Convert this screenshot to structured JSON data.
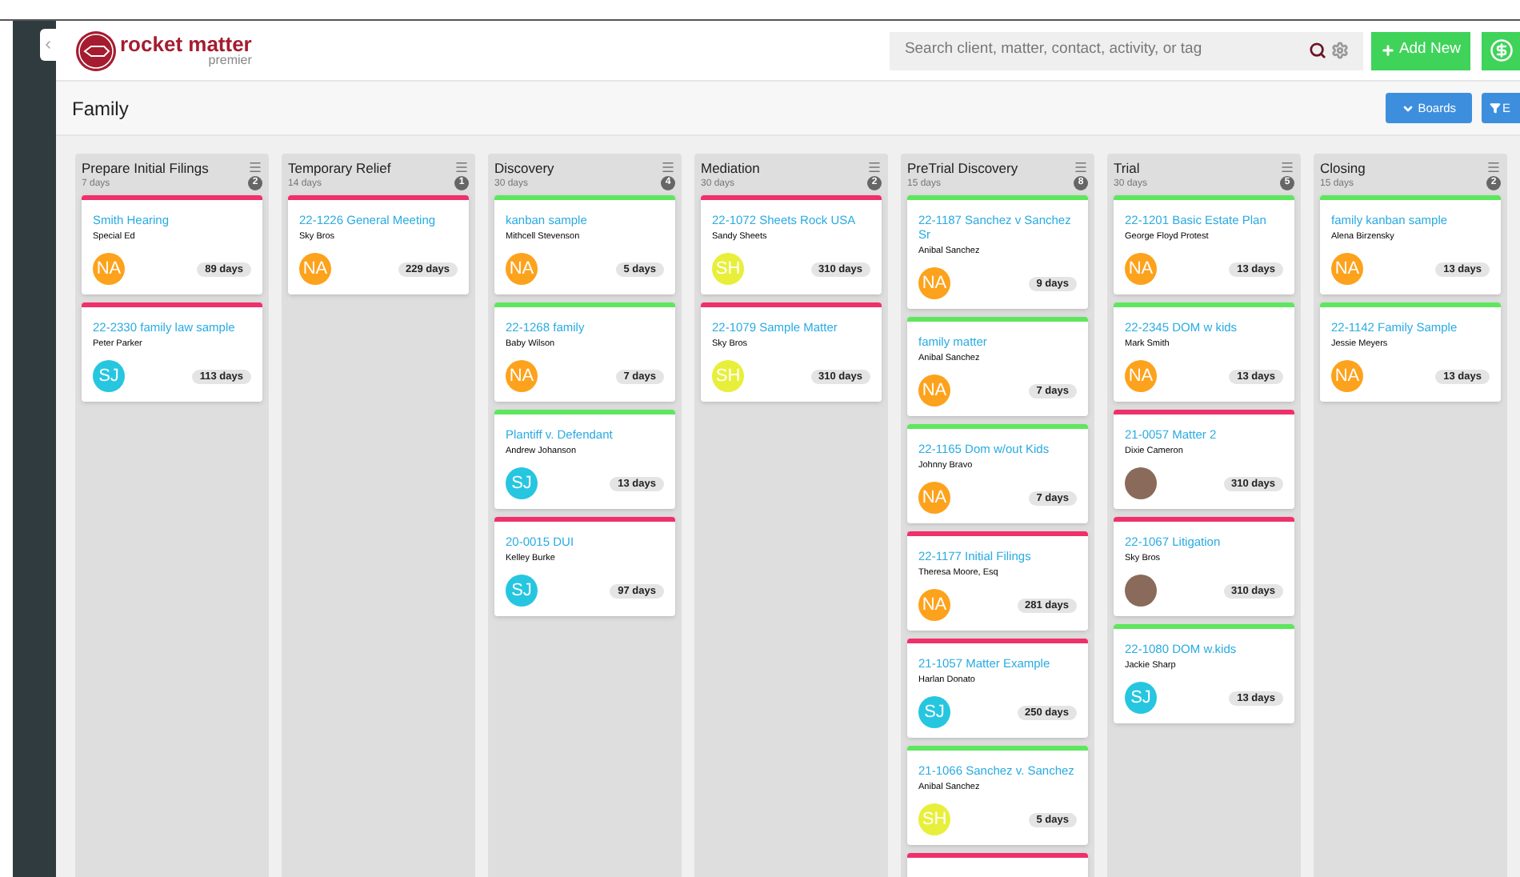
{
  "logo": {
    "name": "rocket matter",
    "tier": "premier"
  },
  "search": {
    "placeholder": "Search client, matter, contact, activity, or tag"
  },
  "add_button": {
    "label": "Add New"
  },
  "page_title": "Family",
  "boards_button": {
    "label": "Boards"
  },
  "filter_button": {
    "label": "E"
  },
  "columns": [
    {
      "title": "Prepare Initial Filings",
      "duration": "7 days",
      "count": "2",
      "cards": [
        {
          "color": "#f0306a",
          "title": "Smith Hearing",
          "client": "Special Ed",
          "avatar": {
            "kind": "initials",
            "text": "NA",
            "color": "#fda21c"
          },
          "age": "89 days"
        },
        {
          "color": "#f0306a",
          "title": "22-2330 family law sample",
          "client": "Peter Parker",
          "avatar": {
            "kind": "initials",
            "text": "SJ",
            "color": "#26c6e0"
          },
          "age": "113 days"
        }
      ]
    },
    {
      "title": "Temporary Relief",
      "duration": "14 days",
      "count": "1",
      "cards": [
        {
          "color": "#f0306a",
          "title": "22-1226 General Meeting",
          "client": "Sky Bros",
          "avatar": {
            "kind": "initials",
            "text": "NA",
            "color": "#fda21c"
          },
          "age": "229 days"
        }
      ]
    },
    {
      "title": "Discovery",
      "duration": "30 days",
      "count": "4",
      "cards": [
        {
          "color": "#5ee65e",
          "title": "kanban sample",
          "client": "Mithcell Stevenson",
          "avatar": {
            "kind": "initials",
            "text": "NA",
            "color": "#fda21c"
          },
          "age": "5 days"
        },
        {
          "color": "#5ee65e",
          "title": "22-1268 family",
          "client": "Baby Wilson",
          "avatar": {
            "kind": "initials",
            "text": "NA",
            "color": "#fda21c"
          },
          "age": "7 days"
        },
        {
          "color": "#5ee65e",
          "title": "Plantiff v. Defendant",
          "client": "Andrew Johanson",
          "avatar": {
            "kind": "initials",
            "text": "SJ",
            "color": "#26c6e0"
          },
          "age": "13 days"
        },
        {
          "color": "#f0306a",
          "title": "20-0015 DUI",
          "client": "Kelley Burke",
          "avatar": {
            "kind": "initials",
            "text": "SJ",
            "color": "#26c6e0"
          },
          "age": "97 days"
        }
      ]
    },
    {
      "title": "Mediation",
      "duration": "30 days",
      "count": "2",
      "cards": [
        {
          "color": "#f0306a",
          "title": "22-1072 Sheets Rock USA",
          "client": "Sandy Sheets",
          "avatar": {
            "kind": "initials",
            "text": "SH",
            "color": "#e8ef3a"
          },
          "age": "310 days"
        },
        {
          "color": "#f0306a",
          "title": "22-1079 Sample Matter",
          "client": "Sky Bros",
          "avatar": {
            "kind": "initials",
            "text": "SH",
            "color": "#e8ef3a"
          },
          "age": "310 days"
        }
      ]
    },
    {
      "title": "PreTrial Discovery",
      "duration": "15 days",
      "count": "8",
      "cards": [
        {
          "color": "#5ee65e",
          "title": "22-1187 Sanchez v Sanchez Sr",
          "client": "Anibal Sanchez",
          "avatar": {
            "kind": "initials",
            "text": "NA",
            "color": "#fda21c"
          },
          "age": "9 days"
        },
        {
          "color": "#5ee65e",
          "title": "family matter",
          "client": "Anibal Sanchez",
          "avatar": {
            "kind": "initials",
            "text": "NA",
            "color": "#fda21c"
          },
          "age": "7 days"
        },
        {
          "color": "#5ee65e",
          "title": "22-1165 Dom w/out Kids",
          "client": "Johnny Bravo",
          "avatar": {
            "kind": "initials",
            "text": "NA",
            "color": "#fda21c"
          },
          "age": "7 days"
        },
        {
          "color": "#f0306a",
          "title": "22-1177 Initial Filings",
          "client": "Theresa Moore, Esq",
          "avatar": {
            "kind": "initials",
            "text": "NA",
            "color": "#fda21c"
          },
          "age": "281 days"
        },
        {
          "color": "#f0306a",
          "title": "21-1057 Matter Example",
          "client": "Harlan Donato",
          "avatar": {
            "kind": "initials",
            "text": "SJ",
            "color": "#26c6e0"
          },
          "age": "250 days"
        },
        {
          "color": "#5ee65e",
          "title": "21-1066 Sanchez v. Sanchez",
          "client": "Anibal Sanchez",
          "avatar": {
            "kind": "initials",
            "text": "SH",
            "color": "#e8ef3a"
          },
          "age": "5 days"
        },
        {
          "color": "#f0306a"
        }
      ]
    },
    {
      "title": "Trial",
      "duration": "30 days",
      "count": "5",
      "cards": [
        {
          "color": "#5ee65e",
          "title": "22-1201 Basic Estate Plan",
          "client": "George Floyd Protest",
          "avatar": {
            "kind": "initials",
            "text": "NA",
            "color": "#fda21c"
          },
          "age": "13 days"
        },
        {
          "color": "#5ee65e",
          "title": "22-2345 DOM w kids",
          "client": "Mark Smith",
          "avatar": {
            "kind": "initials",
            "text": "NA",
            "color": "#fda21c"
          },
          "age": "13 days"
        },
        {
          "color": "#f0306a",
          "title": "21-0057 Matter 2",
          "client": "Dixie Cameron",
          "avatar": {
            "kind": "photo"
          },
          "age": "310 days"
        },
        {
          "color": "#f0306a",
          "title": "22-1067 Litigation",
          "client": "Sky Bros",
          "avatar": {
            "kind": "photo"
          },
          "age": "310 days"
        },
        {
          "color": "#5ee65e",
          "title": "22-1080 DOM w.kids",
          "client": "Jackie Sharp",
          "avatar": {
            "kind": "initials",
            "text": "SJ",
            "color": "#26c6e0"
          },
          "age": "13 days"
        }
      ]
    },
    {
      "title": "Closing",
      "duration": "15 days",
      "count": "2",
      "cards": [
        {
          "color": "#5ee65e",
          "title": "family kanban sample",
          "client": "Alena Birzensky",
          "avatar": {
            "kind": "initials",
            "text": "NA",
            "color": "#fda21c"
          },
          "age": "13 days"
        },
        {
          "color": "#5ee65e",
          "title": "22-1142 Family Sample",
          "client": "Jessie Meyers",
          "avatar": {
            "kind": "initials",
            "text": "NA",
            "color": "#fda21c"
          },
          "age": "13 days"
        }
      ]
    }
  ]
}
